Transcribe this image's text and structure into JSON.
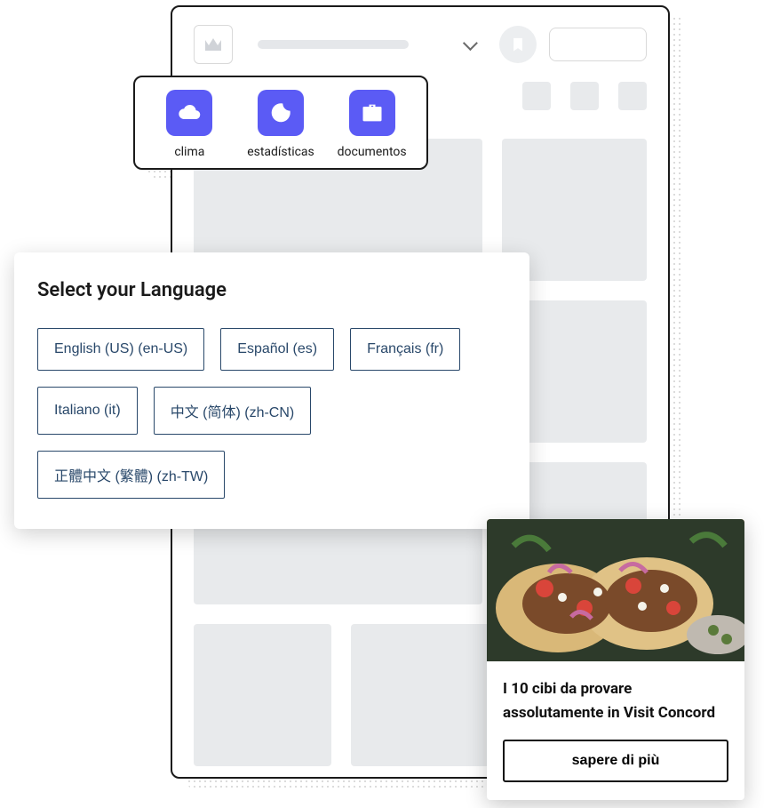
{
  "apps": [
    {
      "label": "clima",
      "icon": "cloud-icon"
    },
    {
      "label": "estadísticas",
      "icon": "moon-icon"
    },
    {
      "label": "documentos",
      "icon": "briefcase-icon"
    }
  ],
  "language_panel": {
    "title": "Select your Language",
    "options": [
      "English (US) (en-US)",
      "Español (es)",
      "Français (fr)",
      "Italiano (it)",
      "中文 (简体) (zh-CN)",
      "正體中文 (繁體) (zh-TW)"
    ]
  },
  "article": {
    "title": "I 10 cibi da provare assolutamente in Visit Concord",
    "cta": "sapere di più"
  }
}
